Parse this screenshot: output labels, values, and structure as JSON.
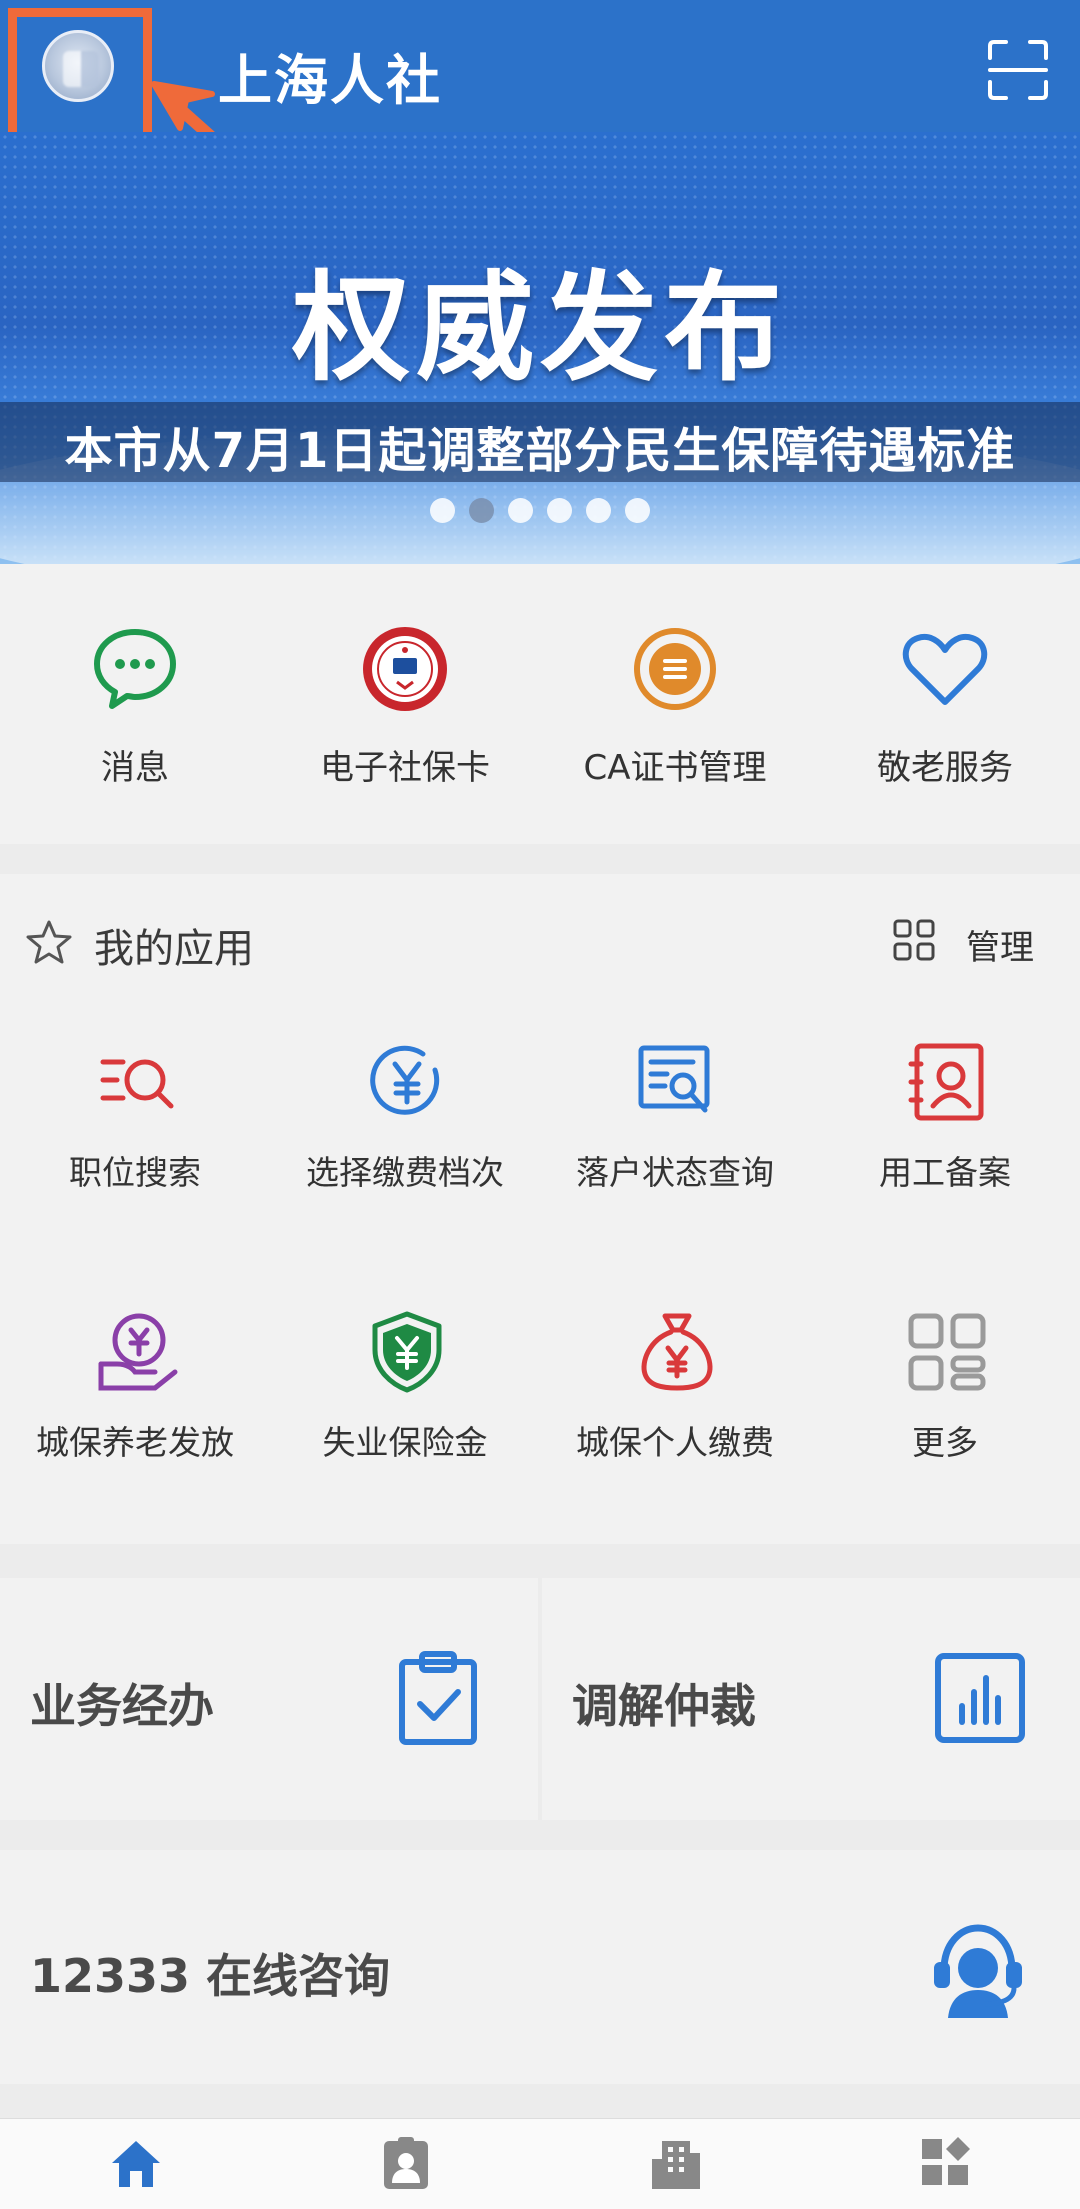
{
  "header": {
    "title": "上海人社",
    "avatar_icon": "avatar-icon",
    "scan_icon": "scan-icon"
  },
  "banner": {
    "headline": "权威发布",
    "caption": "本市从7月1日起调整部分民生保障待遇标准",
    "slide_count": 6,
    "active_slide": 2
  },
  "quick_actions": [
    {
      "label": "消息",
      "icon": "chat-bubble-icon",
      "color": "#1f9a4e"
    },
    {
      "label": "电子社保卡",
      "icon": "social-security-card-icon",
      "color": "#c8262c"
    },
    {
      "label": "CA证书管理",
      "icon": "certificate-icon",
      "color": "#e08a2b"
    },
    {
      "label": "敬老服务",
      "icon": "heart-icon",
      "color": "#2f7bd6"
    }
  ],
  "my_apps": {
    "title": "我的应用",
    "manage_label": "管理",
    "items": [
      {
        "label": "职位搜索",
        "icon": "job-search-icon",
        "color": "#d9393b"
      },
      {
        "label": "选择缴费档次",
        "icon": "yuan-circle-icon",
        "color": "#2f7bd6"
      },
      {
        "label": "落户状态查询",
        "icon": "document-search-icon",
        "color": "#2f7bd6"
      },
      {
        "label": "用工备案",
        "icon": "id-card-icon",
        "color": "#d9393b"
      },
      {
        "label": "城保养老发放",
        "icon": "yuan-hand-icon",
        "color": "#8a3fa8"
      },
      {
        "label": "失业保险金",
        "icon": "yuan-shield-icon",
        "color": "#1f8a44"
      },
      {
        "label": "城保个人缴费",
        "icon": "money-bag-icon",
        "color": "#d9393b"
      },
      {
        "label": "更多",
        "icon": "grid-more-icon",
        "color": "#9a9a9a"
      }
    ]
  },
  "panels": [
    {
      "label": "业务经办",
      "icon": "clipboard-check-icon"
    },
    {
      "label": "调解仲裁",
      "icon": "bar-chart-icon"
    }
  ],
  "consult": {
    "label": "12333 在线咨询",
    "icon": "headset-agent-icon"
  },
  "bottom_nav": [
    {
      "icon": "home-icon",
      "active": true
    },
    {
      "icon": "profile-card-icon",
      "active": false
    },
    {
      "icon": "building-icon",
      "active": false
    },
    {
      "icon": "apps-icon",
      "active": false
    }
  ],
  "colors": {
    "primary": "#2c72c9",
    "highlight": "#ef6a3a"
  }
}
